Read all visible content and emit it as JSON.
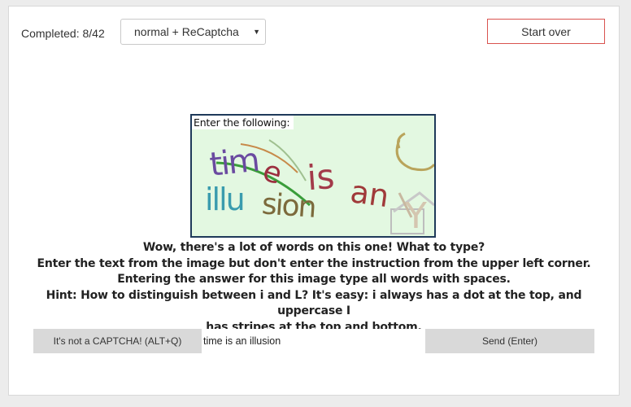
{
  "header": {
    "completed": "Completed: 8/42",
    "mode_select": {
      "selected": "normal + ReCaptcha"
    },
    "start_over_label": "Start over"
  },
  "captcha": {
    "instruction": "Enter the following:",
    "distorted_text": "time is an illusion"
  },
  "hint_lines": [
    "Wow, there's a lot of words on this one! What to type?",
    "Enter the text from the image but don't enter the instruction from the upper left corner.",
    "Entering the answer for this image type all words with spaces.",
    "Hint: How to distinguish between i and L? It's easy: i always has a dot at the top, and uppercase I",
    "has stripes at the top and bottom."
  ],
  "answer": {
    "not_captcha_label": "It's not a CAPTCHA! (ALT+Q)",
    "input_value": "time is an illusion",
    "send_label": "Send (Enter)"
  },
  "colors": {
    "captcha_bg": "#e3f8e1",
    "captcha_border": "#1f3a5a",
    "start_over_border": "#d9534f"
  }
}
